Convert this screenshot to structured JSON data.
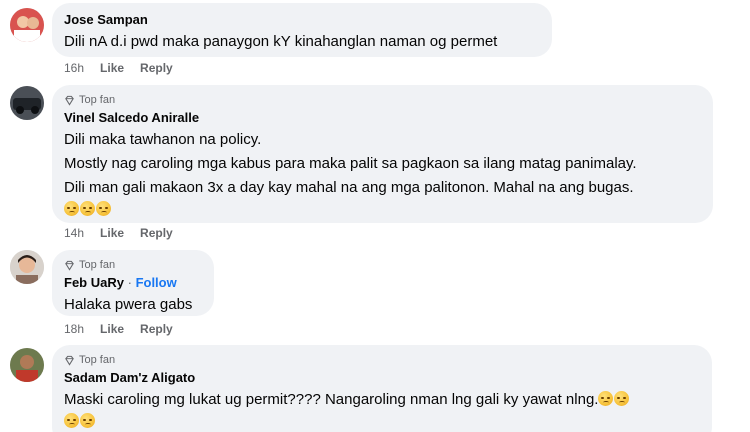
{
  "comments": [
    {
      "author": "Jose Sampan",
      "badge": "",
      "follow": "",
      "lines": [
        "Dili nA d.i pwd maka panaygon kY kinahanglan naman og permet"
      ],
      "time": "16h",
      "like": "Like",
      "reply": "Reply",
      "avatar_color": "#b7322c"
    },
    {
      "author": "Vinel Salcedo Aniralle",
      "badge": "Top fan",
      "follow": "",
      "lines": [
        "Dili maka tawhanon na policy.",
        "Mostly nag caroling mga kabus para maka palit sa pagkaon sa ilang matag panimalay.",
        "Dili man gali makaon 3x a day kay mahal na ang mga palitonon. Mahal na ang bugas."
      ],
      "emojis": 3,
      "time": "14h",
      "like": "Like",
      "reply": "Reply",
      "avatar_color": "#3a3f46"
    },
    {
      "author": "Feb UaRy",
      "badge": "Top fan",
      "follow": "Follow",
      "lines": [
        "Halaka pwera gabs"
      ],
      "time": "18h",
      "like": "Like",
      "reply": "Reply",
      "avatar_color": "#c98a6b"
    },
    {
      "author": "Sadam Dam'z Aligato",
      "badge": "Top fan",
      "follow": "",
      "lines": [
        "Maski caroling mg lukat ug permit???? Nangaroling nman lng gali ky yawat nlng."
      ],
      "trailing_emojis": 2,
      "extra_emojis": 2,
      "avatar_color": "#8a4a2e"
    }
  ]
}
